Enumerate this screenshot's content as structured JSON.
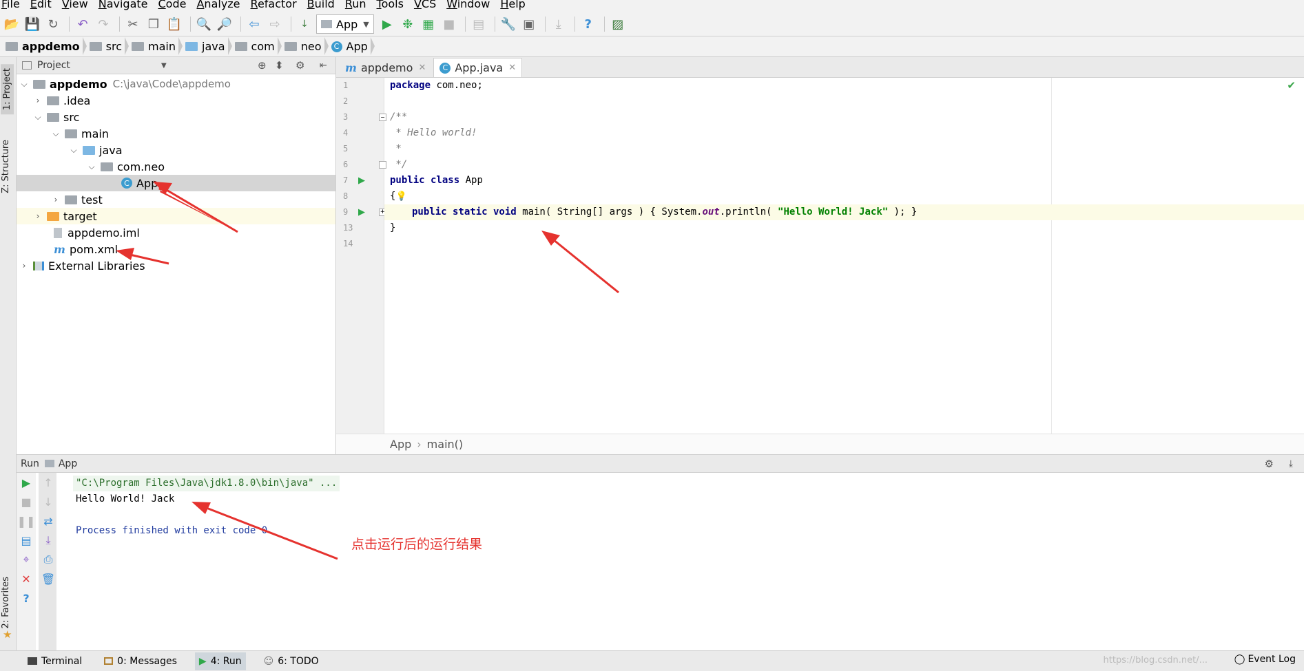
{
  "menubar": {
    "items": [
      "File",
      "Edit",
      "View",
      "Navigate",
      "Code",
      "Analyze",
      "Refactor",
      "Build",
      "Run",
      "Tools",
      "VCS",
      "Window",
      "Help"
    ]
  },
  "toolbar": {
    "run_config": "App"
  },
  "breadcrumb": [
    "appdemo",
    "src",
    "main",
    "java",
    "com",
    "neo",
    "App"
  ],
  "sidebar": {
    "project_tab": "1: Project",
    "structure_tab": "Z: Structure",
    "favorites_tab": "2: Favorites"
  },
  "project": {
    "header": "Project",
    "root_name": "appdemo",
    "root_path": "C:\\java\\Code\\appdemo",
    "items": {
      "idea": ".idea",
      "src": "src",
      "main": "main",
      "java": "java",
      "pkg": "com.neo",
      "app": "App",
      "test": "test",
      "target": "target",
      "iml": "appdemo.iml",
      "pom": "pom.xml",
      "ext": "External Libraries"
    }
  },
  "editor": {
    "tabs": [
      {
        "label": "appdemo"
      },
      {
        "label": "App.java"
      }
    ],
    "line_numbers": [
      "1",
      "2",
      "3",
      "4",
      "5",
      "6",
      "7",
      "8",
      "9",
      "13",
      "14"
    ],
    "code": {
      "l1_kw": "package",
      "l1_rest": " com.neo;",
      "l3": "/**",
      "l4": " * Hello world!",
      "l5": " *",
      "l6": " */",
      "l7_kw": "public class",
      "l7_rest": " App",
      "l8": "{",
      "l9_kw": "public static void",
      "l9_a": " main( String[] args ) { System.",
      "l9_out": "out",
      "l9_b": ".println( ",
      "l9_str": "\"Hello World! Jack\"",
      "l9_c": " ); }",
      "l13": "}"
    },
    "footer_class": "App",
    "footer_method": "main()"
  },
  "run": {
    "label": "Run",
    "config": "App",
    "console": [
      "\"C:\\Program Files\\Java\\jdk1.8.0\\bin\\java\" ...",
      "Hello World! Jack",
      "",
      "Process finished with exit code 0"
    ],
    "annotation": "点击运行后的运行结果"
  },
  "statusbar": {
    "terminal": "Terminal",
    "messages": "0: Messages",
    "run": "4: Run",
    "todo": "6: TODO",
    "event_log": "Event Log",
    "watermark": "https://blog.csdn.net/..."
  },
  "colors": {
    "keyword": "#000080",
    "string": "#008000",
    "comment": "#808080",
    "annotation": "#e5322e",
    "selection": "#d5d5d5"
  }
}
